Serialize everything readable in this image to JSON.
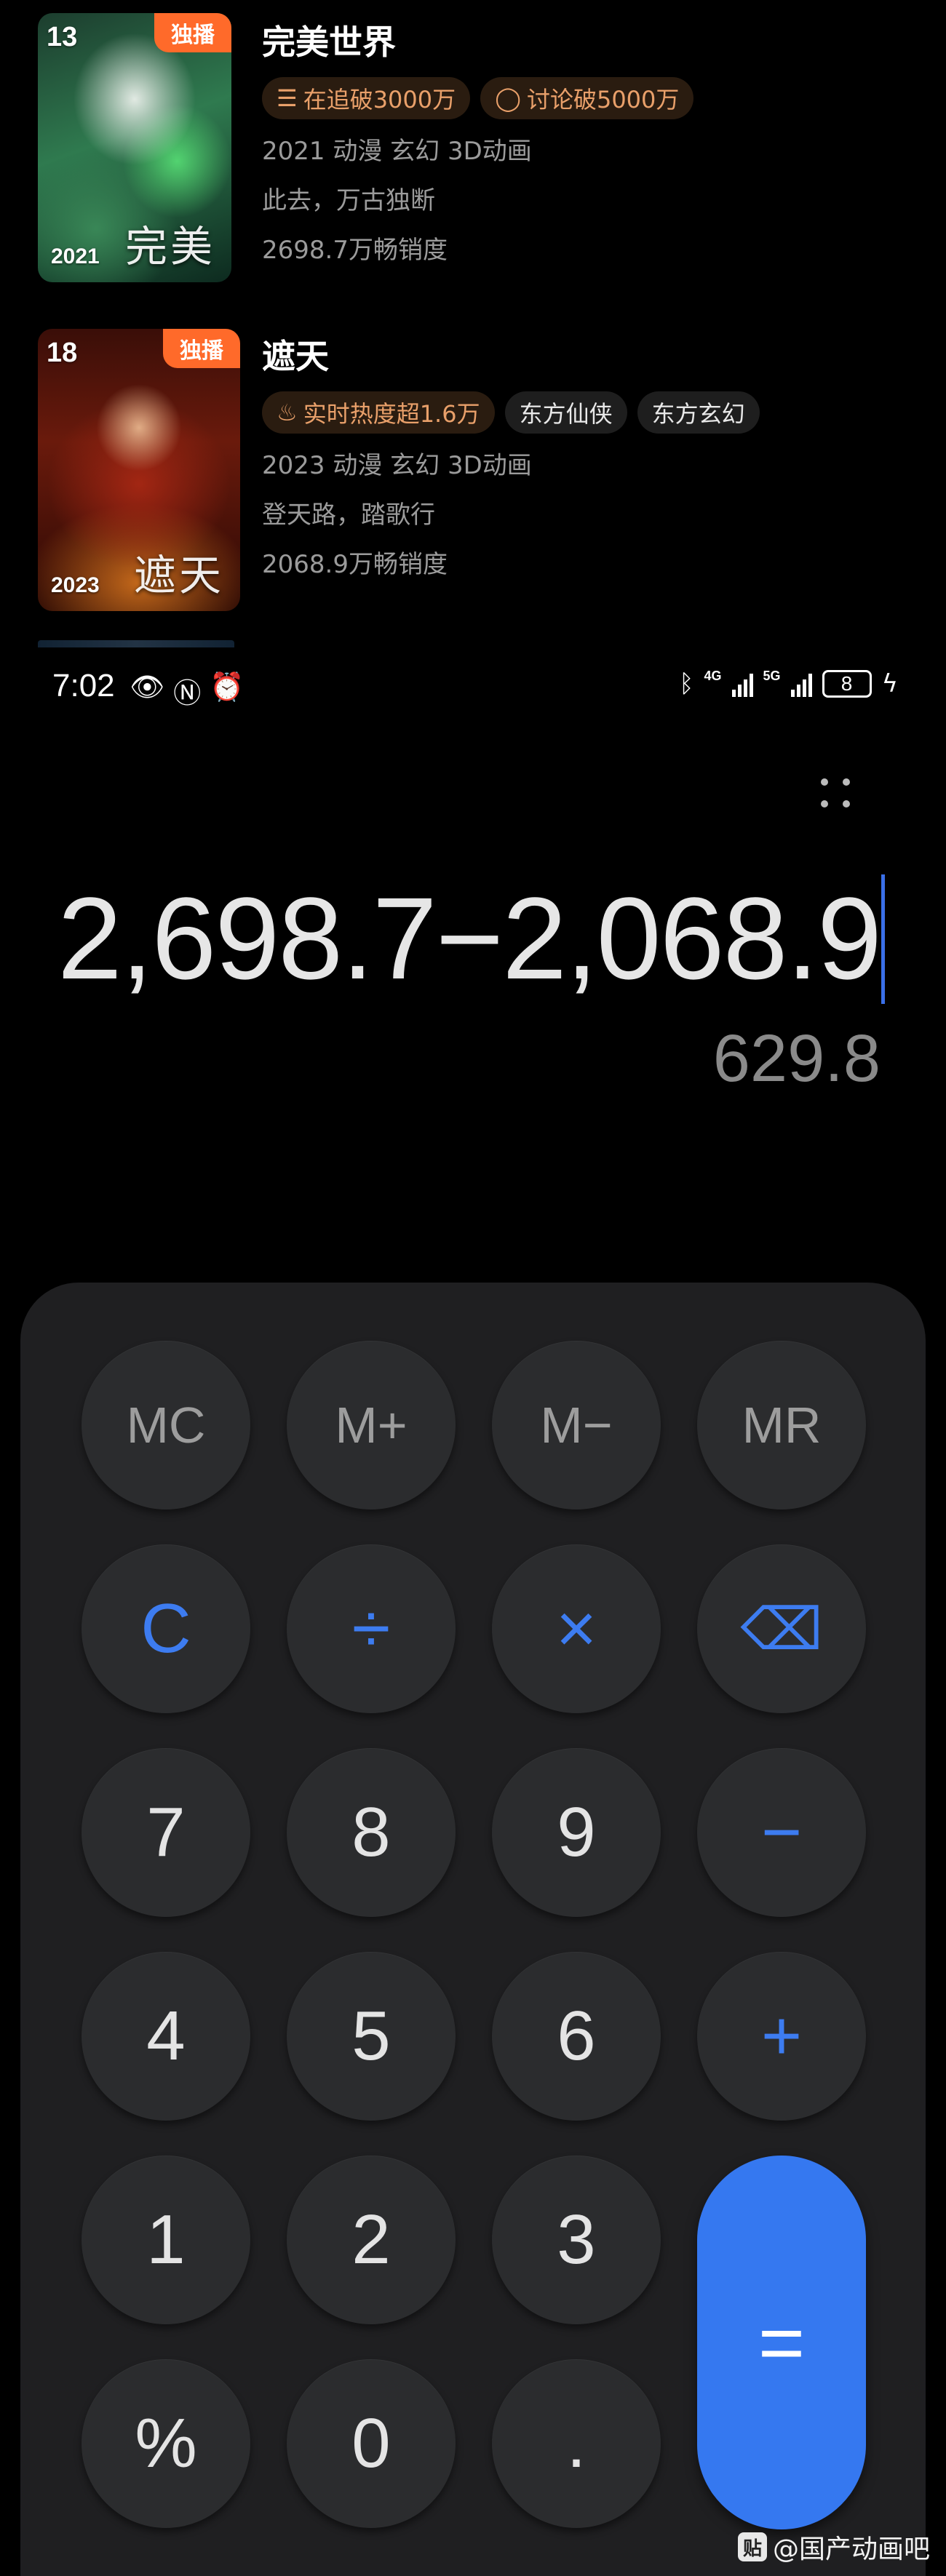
{
  "anime_list": {
    "items": [
      {
        "rank": "13",
        "badge": "独播",
        "poster_year": "2021",
        "poster_logo": "完美",
        "title": "完美世界",
        "tags": [
          {
            "icon": "list-icon",
            "label": "在追破3000万"
          },
          {
            "icon": "chat-bubble-icon",
            "label": "讨论破5000万"
          }
        ],
        "meta": [
          "2021 动漫 玄幻 3D动画",
          "此去，万古独断",
          "2698.7万畅销度"
        ]
      },
      {
        "rank": "18",
        "badge": "独播",
        "poster_year": "2023",
        "poster_logo": "遮天",
        "title": "遮天",
        "tags": [
          {
            "icon": "flame-icon",
            "label": "实时热度超1.6万"
          },
          {
            "icon": "",
            "label": "东方仙侠"
          },
          {
            "icon": "",
            "label": "东方玄幻"
          }
        ],
        "meta": [
          "2023 动漫 玄幻 3D动画",
          "登天路，踏歌行",
          "2068.9万畅销度"
        ]
      }
    ]
  },
  "status_bar": {
    "time": "7:02",
    "network_a": "4G",
    "network_b": "5G",
    "battery": "8"
  },
  "calculator": {
    "expression": "2,698.7−2,068.9",
    "result": "629.8",
    "keys": {
      "mc": "MC",
      "mplus": "M+",
      "mminus": "M−",
      "mr": "MR",
      "clear": "C",
      "divide": "÷",
      "multiply": "×",
      "backspace": "⌫",
      "seven": "7",
      "eight": "8",
      "nine": "9",
      "minus": "−",
      "four": "4",
      "five": "5",
      "six": "6",
      "plus": "+",
      "one": "1",
      "two": "2",
      "three": "3",
      "equals": "=",
      "percent": "%",
      "zero": "0",
      "dot": "."
    },
    "accent_color": "#3578f0"
  },
  "watermark": {
    "logo": "贴",
    "text": "@国产动画吧"
  }
}
